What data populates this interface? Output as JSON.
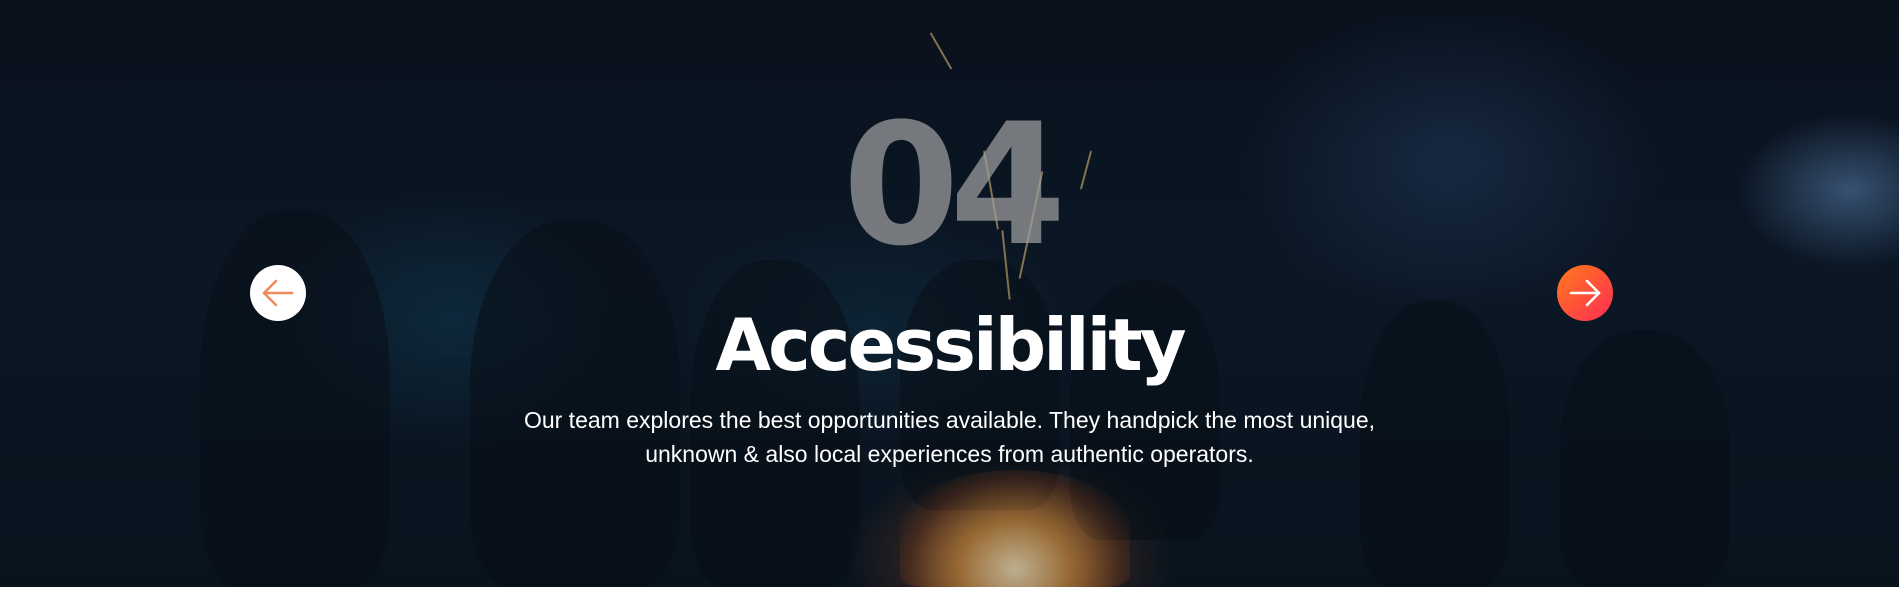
{
  "slide": {
    "number": "04",
    "title": "Accessibility",
    "description_line1": "Our team explores the best opportunities available. They handpick the most unique,",
    "description_line2": "unknown & also local experiences from authentic operators."
  },
  "navigation": {
    "prev_icon": "arrow-left-icon",
    "next_icon": "arrow-right-icon"
  },
  "colors": {
    "prev_arrow": "#f08a5d",
    "next_gradient_start": "#ff7a1a",
    "next_gradient_end": "#ff2d55",
    "title": "#ffffff"
  }
}
